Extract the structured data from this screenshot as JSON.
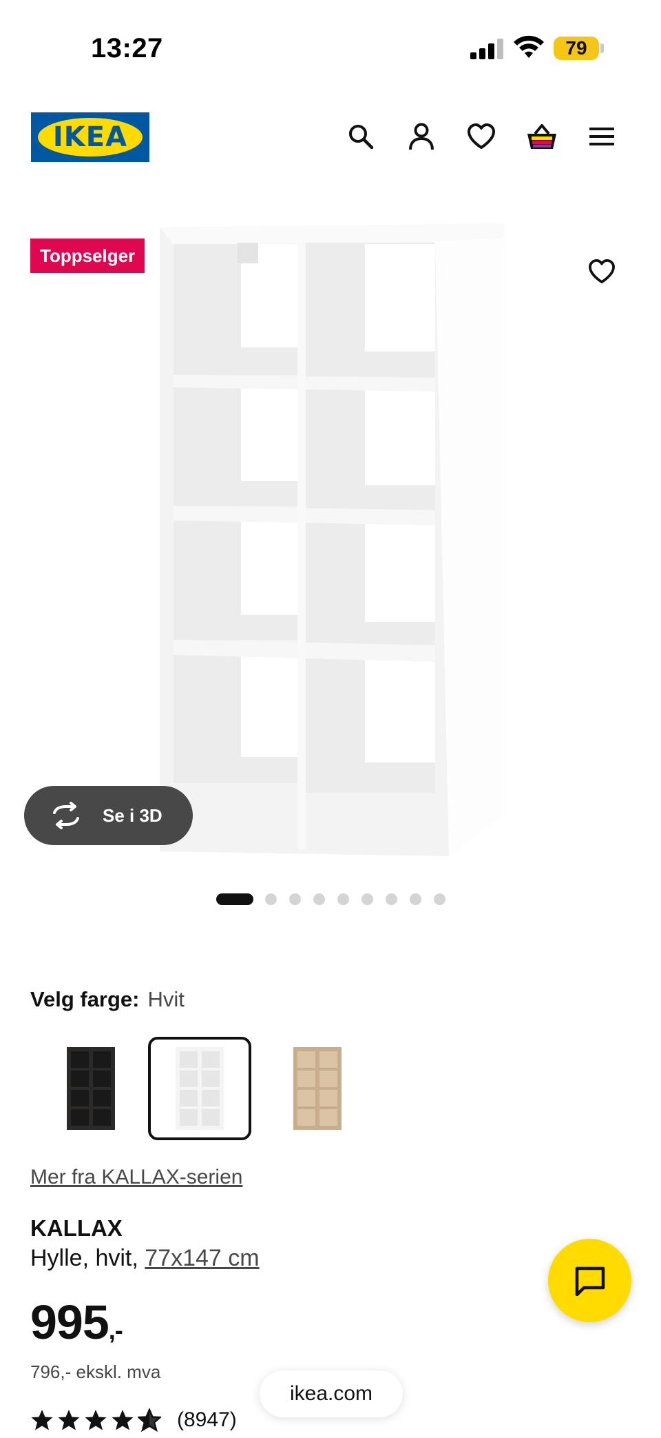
{
  "status_bar": {
    "time": "13:27",
    "battery": "79"
  },
  "header": {
    "logo_text": "IKEA",
    "icons": [
      "search-icon",
      "user-icon",
      "heart-icon",
      "basket-icon",
      "menu-icon"
    ]
  },
  "product_image": {
    "badge": "Toppselger",
    "view_3d_label": "Se i 3D",
    "image_count": 9,
    "active_image": 1
  },
  "color_selector": {
    "label": "Velg farge:",
    "selected_value": "Hvit",
    "swatch_colors": [
      "#2c2a29",
      "#ffffff",
      "#c9ae8e"
    ],
    "selected_index": 1
  },
  "product": {
    "series_link": "Mer fra KALLAX-serien",
    "name": "KALLAX",
    "description": "Hylle, hvit, ",
    "size_link": "77x147 cm",
    "price_main": "995",
    "price_suffix": ",-",
    "price_ex_vat": "796,- ekskl. mva",
    "rating_stars": 4.5,
    "rating_count": "(8947)"
  },
  "browser": {
    "url": "ikea.com"
  },
  "colors": {
    "ikea_blue": "#0058a3",
    "ikea_yellow": "#ffdb00",
    "badge_red": "#e00751"
  }
}
